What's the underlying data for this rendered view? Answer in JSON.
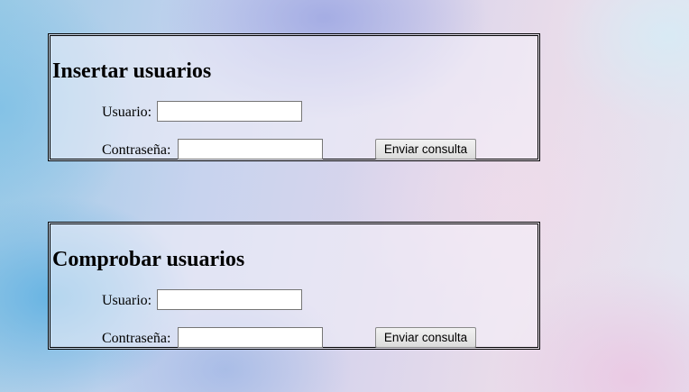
{
  "forms": {
    "insert": {
      "title": "Insertar usuarios",
      "user_label": "Usuario:",
      "user_value": "",
      "password_label": "Contraseña:",
      "password_value": "",
      "submit_label": "Enviar consulta"
    },
    "check": {
      "title": "Comprobar usuarios",
      "user_label": "Usuario:",
      "user_value": "",
      "password_label": "Contraseña:",
      "password_value": "",
      "submit_label": "Enviar consulta"
    }
  }
}
